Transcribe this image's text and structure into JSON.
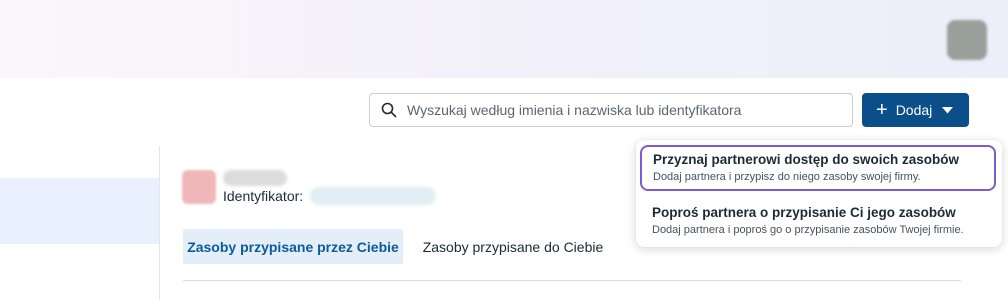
{
  "header": {
    "avatar_alt": "user-avatar"
  },
  "search": {
    "placeholder": "Wyszukaj według imienia i nazwiska lub identyfikatora",
    "value": ""
  },
  "add_button": {
    "label": "Dodaj"
  },
  "profile": {
    "id_label": "Identyfikator:"
  },
  "tabs": [
    {
      "label": "Zasoby przypisane przez Ciebie",
      "active": true
    },
    {
      "label": "Zasoby przypisane do Ciebie",
      "active": false
    }
  ],
  "dropdown": {
    "items": [
      {
        "title": "Przyznaj partnerowi dostęp do swoich zasobów",
        "description": "Dodaj partnera i przypisz do niego zasoby swojej firmy."
      },
      {
        "title": "Poproś partnera o przypisanie Ci jego zasobów",
        "description": "Dodaj partnera i poproś go o przypisanie zasobów Twojej firmie."
      }
    ]
  },
  "colors": {
    "primary": "#0b4f8a",
    "focus_ring": "#7b5cd6",
    "active_tab_bg": "#e3eef8",
    "active_tab_text": "#0b5b9a"
  },
  "icons": {
    "search": "search-icon",
    "plus": "plus-icon",
    "caret": "caret-down-icon"
  }
}
